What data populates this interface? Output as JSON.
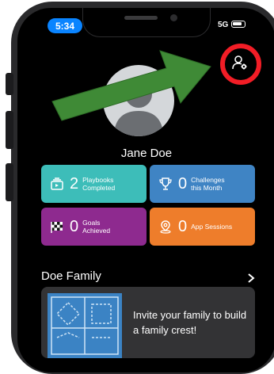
{
  "status_bar": {
    "time": "5:34",
    "network": "5G"
  },
  "profile": {
    "name": "Jane Doe"
  },
  "stats": [
    {
      "value": "2",
      "label_lines": [
        "Playbooks",
        "Completed"
      ],
      "color": "#3dbdb9",
      "icon": "playbook-icon"
    },
    {
      "value": "0",
      "label_lines": [
        "Challenges",
        "this Month"
      ],
      "color": "#3f84c4",
      "icon": "trophy-icon"
    },
    {
      "value": "0",
      "label_lines": [
        "Goals",
        "Achieved"
      ],
      "color": "#8e2a8f",
      "icon": "checkered-flag-icon"
    },
    {
      "value": "0",
      "label_lines": [
        "App Sessions"
      ],
      "color": "#ee7d2b",
      "icon": "location-icon"
    }
  ],
  "family": {
    "title": "Doe Family",
    "invite_text": "Invite your family to build a family crest!"
  },
  "colors": {
    "annotation_arrow": "#3f8a36",
    "annotation_ring": "#f21d26"
  }
}
